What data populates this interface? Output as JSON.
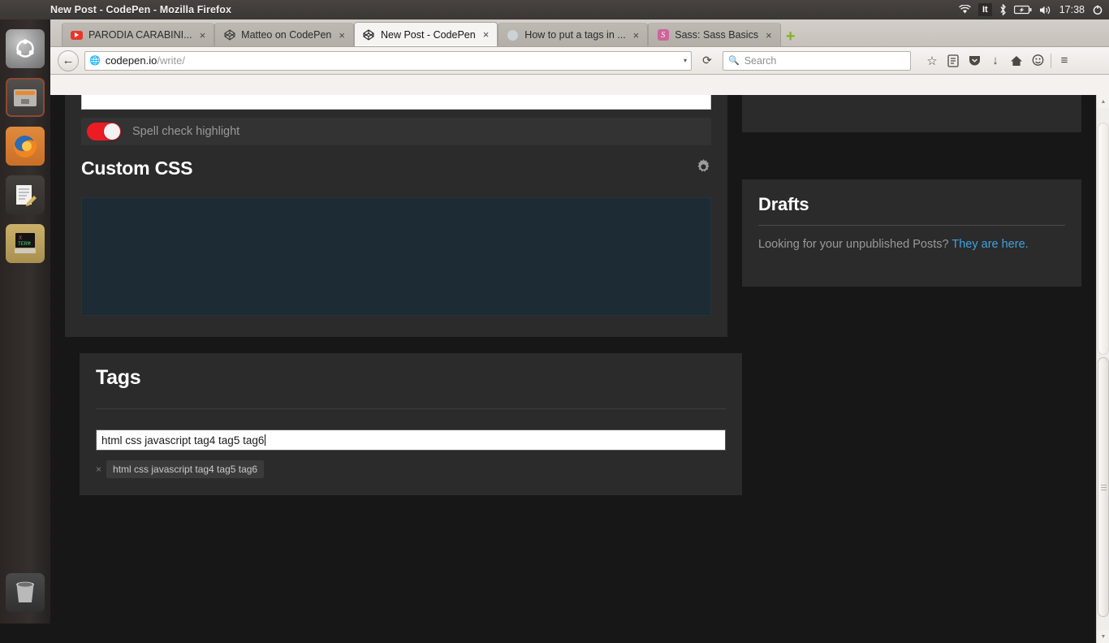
{
  "desktop": {
    "window_title": "New Post - CodePen - Mozilla Firefox",
    "tray": {
      "wifi_icon": "wifi-icon",
      "keyboard_layout": "It",
      "bluetooth_icon": "bluetooth-icon",
      "battery_icon": "battery-icon",
      "volume_icon": "volume-icon",
      "clock": "17:38",
      "power_icon": "power-icon"
    },
    "launcher": [
      {
        "name": "ubuntu-dash",
        "label": "Ubuntu Dash"
      },
      {
        "name": "files",
        "label": "Files"
      },
      {
        "name": "firefox",
        "label": "Firefox"
      },
      {
        "name": "text-editor",
        "label": "Text Editor"
      },
      {
        "name": "xterm",
        "label": "XTerm"
      }
    ],
    "trash_label": "Trash"
  },
  "browser": {
    "tabs": [
      {
        "label": "PARODIA CARABINI...",
        "favicon": "youtube-icon",
        "active": false
      },
      {
        "label": "Matteo on CodePen",
        "favicon": "codepen-icon",
        "active": false
      },
      {
        "label": "New Post - CodePen",
        "favicon": "codepen-icon",
        "active": true
      },
      {
        "label": "How to put a tags in ...",
        "favicon": "page-icon",
        "active": false
      },
      {
        "label": "Sass: Sass Basics",
        "favicon": "sass-icon",
        "active": false
      }
    ],
    "new_tab_label": "+",
    "close_label": "×",
    "back_label": "←",
    "reload_label": "⟳",
    "url_domain": "codepen.io",
    "url_path": "/write/",
    "url_dropdown_label": "▾",
    "search_placeholder": "Search",
    "toolbar_icons": [
      {
        "name": "bookmark-star-icon",
        "glyph": "☆"
      },
      {
        "name": "reader-list-icon",
        "glyph": "☰"
      },
      {
        "name": "pocket-icon",
        "glyph": "▼"
      },
      {
        "name": "downloads-icon",
        "glyph": "↓"
      },
      {
        "name": "home-icon",
        "glyph": "⌂"
      },
      {
        "name": "hello-chat-icon",
        "glyph": "☺"
      },
      {
        "name": "menu-hamburger-icon",
        "glyph": "≡"
      }
    ]
  },
  "page": {
    "spell_check": {
      "label": "Spell check highlight",
      "enabled": true,
      "accent_color": "#ed1c24"
    },
    "custom_css": {
      "title": "Custom CSS",
      "settings_icon": "gear-icon",
      "editor_value": "",
      "editor_bg": "#1d2b34"
    },
    "tags": {
      "title": "Tags",
      "input_value": "html css javascript tag4 tag5 tag6",
      "chips": [
        {
          "remove_label": "×",
          "label": "html css javascript tag4 tag5 tag6"
        }
      ]
    },
    "drafts": {
      "title": "Drafts",
      "text": "Looking for your unpublished Posts?",
      "link_text": "They are here.",
      "link_color": "#3ea2e0"
    },
    "background_color": "#171717",
    "panel_color": "#2b2b2b"
  }
}
